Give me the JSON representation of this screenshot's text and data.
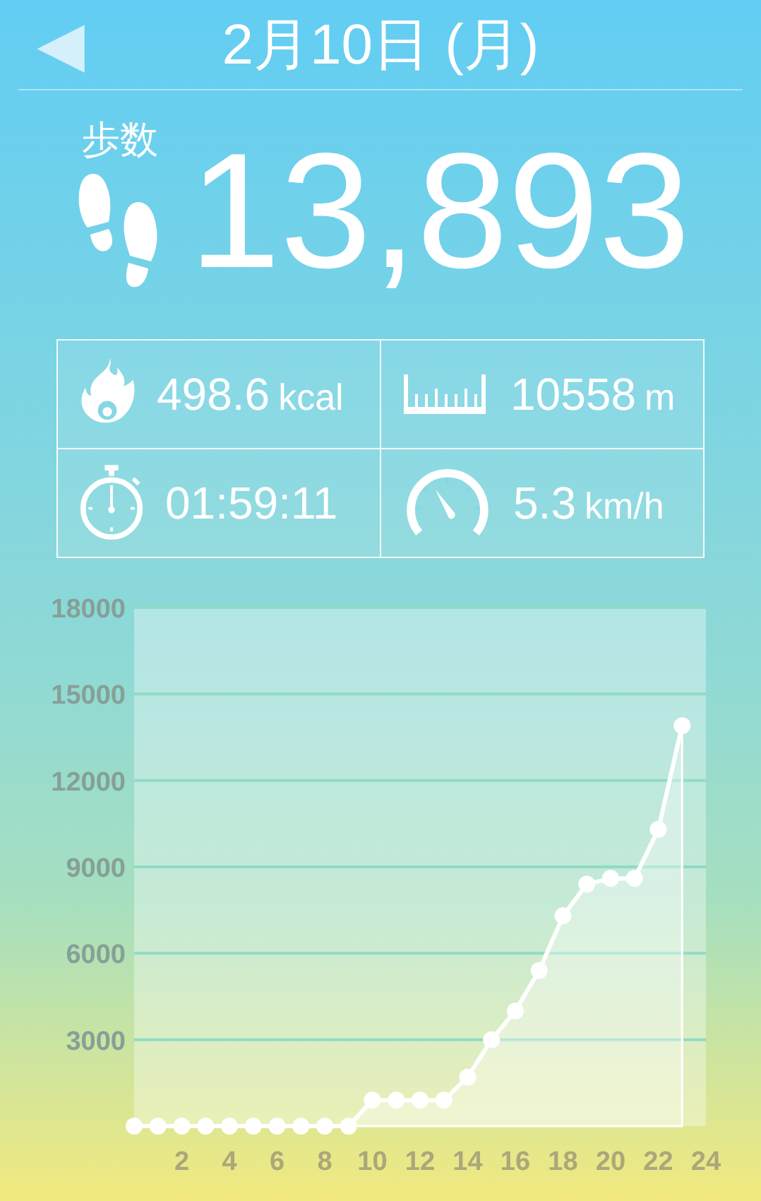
{
  "header": {
    "back_icon": "◀",
    "date": "2月10日 (月)"
  },
  "steps": {
    "label": "歩数",
    "value": "13,893"
  },
  "stats": [
    {
      "kind": "calories",
      "value": "498.6",
      "unit": "kcal"
    },
    {
      "kind": "distance",
      "value": "10558",
      "unit": "m"
    },
    {
      "kind": "time",
      "value": "01:59:11"
    },
    {
      "kind": "speed",
      "value": "5.3",
      "unit": "km/h"
    }
  ],
  "chart": {
    "chart_data": {
      "type": "area",
      "x": [
        0,
        1,
        2,
        3,
        4,
        5,
        6,
        7,
        8,
        9,
        10,
        11,
        12,
        13,
        14,
        15,
        16,
        17,
        18,
        19,
        20,
        21,
        22,
        23
      ],
      "series": [
        {
          "color": "#ffffff",
          "values": [
            0,
            0,
            0,
            0,
            0,
            0,
            0,
            0,
            0,
            0,
            900,
            900,
            900,
            900,
            1700,
            3000,
            4000,
            5400,
            7300,
            8400,
            8600,
            8600,
            10300,
            13900
          ]
        }
      ],
      "grid": true,
      "xlim": [
        0,
        24
      ],
      "ylim": [
        0,
        18000
      ],
      "xticks": [
        2,
        4,
        6,
        8,
        10,
        12,
        14,
        16,
        18,
        20,
        22,
        24
      ],
      "yticks": [
        3000,
        6000,
        9000,
        12000,
        15000,
        18000
      ]
    }
  }
}
